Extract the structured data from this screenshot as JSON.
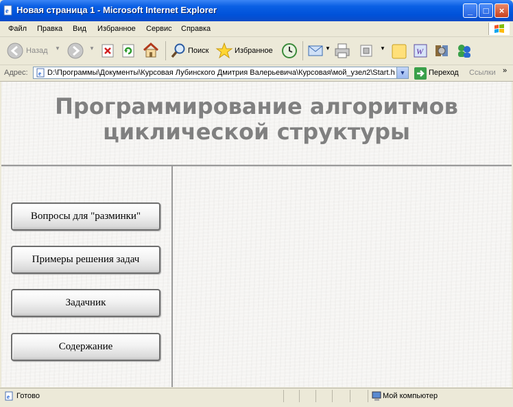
{
  "window": {
    "title": "Новая страница 1 - Microsoft Internet Explorer",
    "controls": {
      "minimize": "_",
      "maximize": "□",
      "close": "×"
    }
  },
  "menu": [
    "Файл",
    "Правка",
    "Вид",
    "Избранное",
    "Сервис",
    "Справка"
  ],
  "toolbar": {
    "back_label": "Назад",
    "search_label": "Поиск",
    "favorites_label": "Избранное"
  },
  "address": {
    "label": "Адрес:",
    "url": "D:\\Программы\\Документы\\Курсовая Лубинского Дмитрия Валерьевича\\Курсовая\\мой_узел2\\Start.h",
    "go_label": "Переход",
    "links_label": "Ссылки",
    "chevron": "»"
  },
  "page": {
    "title_line1": "Программирование алгоритмов",
    "title_line2": "циклической структуры",
    "nav_buttons": [
      "Вопросы для \"разминки\"",
      "Примеры решения задач",
      "Задачник",
      "Содержание"
    ]
  },
  "status": {
    "text": "Готово",
    "zone": "Мой компьютер"
  },
  "colors": {
    "title_text": "#808080",
    "titlebar": "#0a5fe4"
  }
}
